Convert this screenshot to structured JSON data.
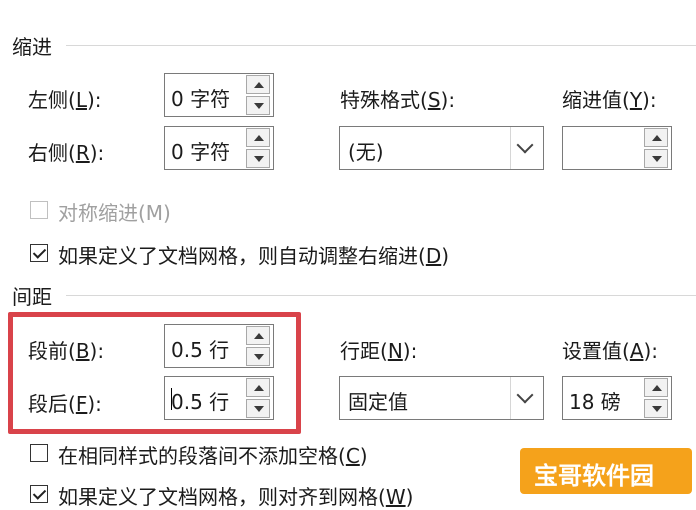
{
  "indent": {
    "section_title": "缩进",
    "left_label_pre": "左侧(",
    "left_label_key": "L",
    "left_label_post": "):",
    "left_value": "0 字符",
    "right_label_pre": "右侧(",
    "right_label_key": "R",
    "right_label_post": "):",
    "right_value": "0 字符",
    "special_label_pre": "特殊格式(",
    "special_label_key": "S",
    "special_label_post": "):",
    "special_value": "(无)",
    "indent_value_label_pre": "缩进值(",
    "indent_value_label_key": "Y",
    "indent_value_label_post": "):",
    "indent_value": "",
    "mirror_label": "对称缩进(M)",
    "mirror_checked": false,
    "mirror_enabled": false,
    "auto_adjust_label_pre": "如果定义了文档网格，则自动调整右缩进(",
    "auto_adjust_label_key": "D",
    "auto_adjust_label_post": ")",
    "auto_adjust_checked": true
  },
  "spacing": {
    "section_title": "间距",
    "before_label_pre": "段前(",
    "before_label_key": "B",
    "before_label_post": "):",
    "before_value": "0.5 行",
    "after_label_pre": "段后(",
    "after_label_key": "F",
    "after_label_post": "):",
    "after_value": "0.5 行",
    "line_spacing_label_pre": "行距(",
    "line_spacing_label_key": "N",
    "line_spacing_label_post": "):",
    "line_spacing_value": "固定值",
    "set_value_label_pre": "设置值(",
    "set_value_label_key": "A",
    "set_value_label_post": "):",
    "set_value": "18 磅",
    "no_space_label_pre": "在相同样式的段落间不添加空格(",
    "no_space_label_key": "C",
    "no_space_label_post": ")",
    "no_space_checked": false,
    "snap_grid_label_pre": "如果定义了文档网格，则对齐到网格(",
    "snap_grid_label_key": "W",
    "snap_grid_label_post": ")",
    "snap_grid_checked": true
  },
  "colors": {
    "highlight": "#d9434a",
    "watermark": "#f5a21b"
  },
  "watermark": {
    "text": "宝哥软件园"
  }
}
